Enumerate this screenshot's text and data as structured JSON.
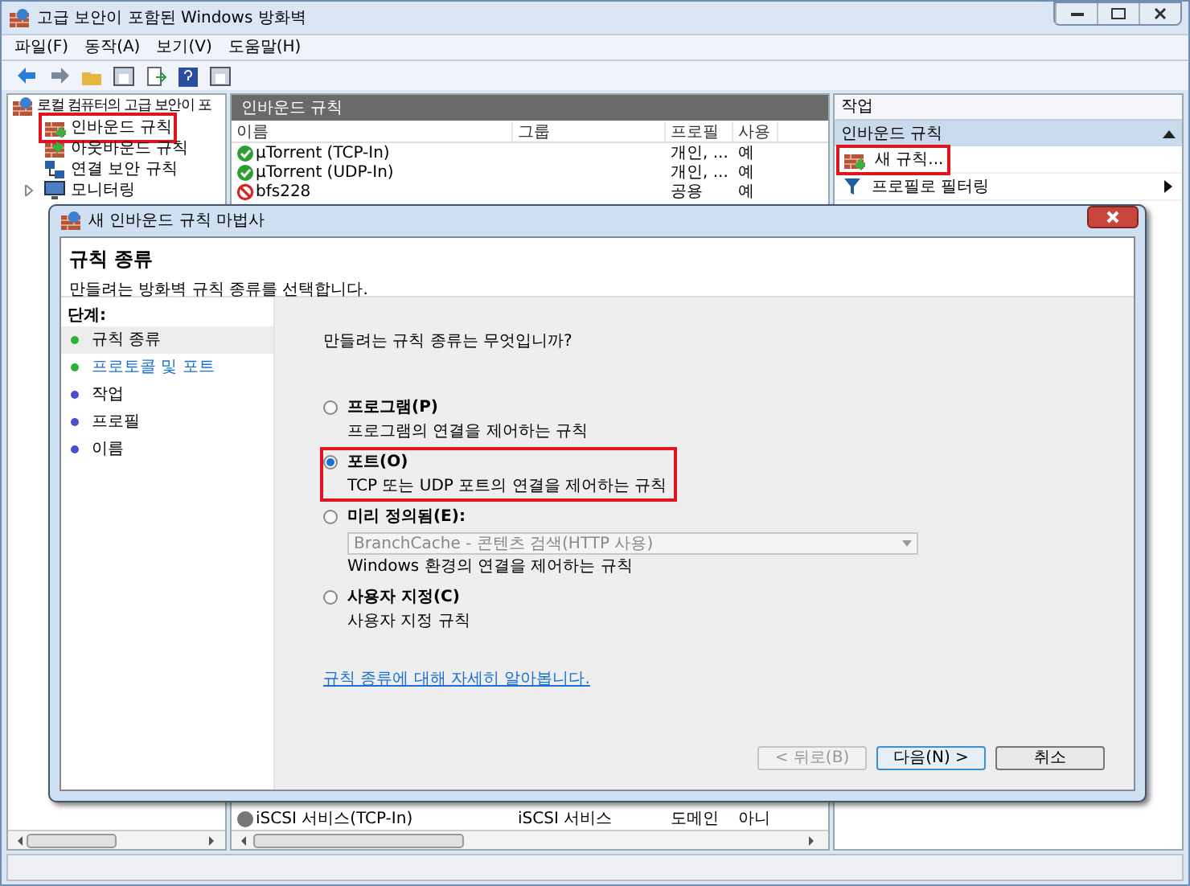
{
  "window": {
    "title": "고급 보안이 포함된 Windows 방화벽"
  },
  "menu": [
    "파일(F)",
    "동작(A)",
    "보기(V)",
    "도움말(H)"
  ],
  "tree": {
    "root": "로컬 컴퓨터의 고급 보안이 포",
    "items": [
      {
        "label": "인바운드 규칙",
        "kind": "inbound",
        "highlighted": true,
        "expandable": false
      },
      {
        "label": "아웃바운드 규칙",
        "kind": "outbound",
        "highlighted": false,
        "expandable": false
      },
      {
        "label": "연결 보안 규칙",
        "kind": "security",
        "highlighted": false,
        "expandable": false
      },
      {
        "label": "모니터링",
        "kind": "monitor",
        "highlighted": false,
        "expandable": true
      }
    ]
  },
  "rules_panel": {
    "title": "인바운드 규칙",
    "columns": [
      "이름",
      "그룹",
      "프로필",
      "사용"
    ],
    "rows": [
      {
        "name": "μTorrent (TCP-In)",
        "group": "",
        "profile": "개인, ...",
        "enabled": "예",
        "kind": "allow"
      },
      {
        "name": "μTorrent (UDP-In)",
        "group": "",
        "profile": "개인, ...",
        "enabled": "예",
        "kind": "allow"
      },
      {
        "name": "bfs228",
        "group": "",
        "profile": "공용",
        "enabled": "예",
        "kind": "block"
      }
    ],
    "bottom_row": {
      "name": "iSCSI 서비스(TCP-In)",
      "group": "iSCSI 서비스",
      "profile": "도메인",
      "enabled": "아니"
    }
  },
  "actions": {
    "title": "작업",
    "section": "인바운드 규칙",
    "items": [
      {
        "label": "새 규칙...",
        "kind": "new",
        "highlighted": true,
        "submenu": false
      },
      {
        "label": "프로필로 필터링",
        "kind": "filter",
        "highlighted": false,
        "submenu": true
      }
    ]
  },
  "dialog": {
    "title": "새 인바운드 규칙 마법사",
    "heading": "규칙 종류",
    "subtitle": "만들려는 방화벽 규칙 종류를 선택합니다.",
    "steps_title": "단계:",
    "steps": [
      {
        "label": "규칙 종류",
        "selected": true,
        "done": true
      },
      {
        "label": "프로토콜 및 포트",
        "selected": false,
        "done": true
      },
      {
        "label": "작업",
        "selected": false,
        "done": false
      },
      {
        "label": "프로필",
        "selected": false,
        "done": false
      },
      {
        "label": "이름",
        "selected": false,
        "done": false
      }
    ],
    "question": "만들려는 규칙 종류는 무엇입니까?",
    "options": [
      {
        "label": "프로그램(P)",
        "description": "프로그램의 연결을 제어하는 규칙",
        "selected": false,
        "highlighted": false
      },
      {
        "label": "포트(O)",
        "description": "TCP 또는 UDP 포트의 연결을 제어하는 규칙",
        "selected": true,
        "highlighted": true
      },
      {
        "label": "미리 정의됨(E):",
        "description": "Windows 환경의 연결을 제어하는 규칙",
        "selected": false,
        "highlighted": false,
        "dropdown": {
          "value": "BranchCache - 콘텐츠 검색(HTTP 사용)",
          "disabled": true
        }
      },
      {
        "label": "사용자 지정(C)",
        "description": "사용자 지정 규칙",
        "selected": false,
        "highlighted": false
      }
    ],
    "link": "규칙 종류에 대해 자세히 알아봅니다.",
    "buttons": [
      {
        "label": "< 뒤로(B)",
        "disabled": true,
        "default": false
      },
      {
        "label": "다음(N) >",
        "disabled": false,
        "default": true
      },
      {
        "label": "취소",
        "disabled": false,
        "default": false
      }
    ]
  }
}
